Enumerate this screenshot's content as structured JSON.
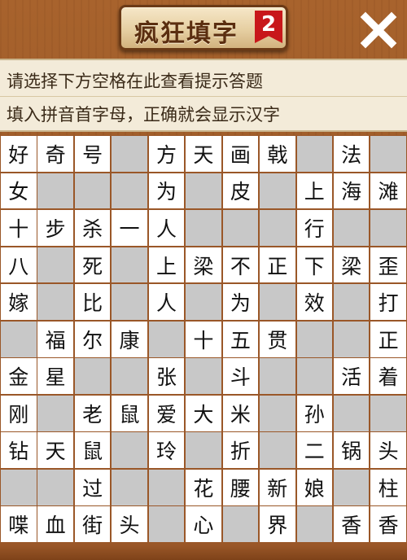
{
  "header": {
    "title": "疯狂填字",
    "level": "2",
    "close_icon": "close-x-icon"
  },
  "hint": {
    "line1": "请选择下方空格在此查看提示答题",
    "line2": "填入拼音首字母，正确就会显示汉字"
  },
  "colors": {
    "wood": "#9a5728",
    "plaque": "#e6cfa2",
    "badge": "#c8171b",
    "blocked_cell": "#c8c8c8",
    "open_cell": "#ffffff"
  },
  "grid": {
    "rows": [
      [
        "好",
        "奇",
        "号",
        null,
        "方",
        "天",
        "画",
        "戟",
        null,
        "法",
        null
      ],
      [
        "女",
        null,
        null,
        null,
        "为",
        null,
        "皮",
        null,
        "上",
        "海",
        "滩"
      ],
      [
        "十",
        "步",
        "杀",
        "一",
        "人",
        null,
        null,
        null,
        "行",
        null,
        null
      ],
      [
        "八",
        null,
        "死",
        null,
        "上",
        "梁",
        "不",
        "正",
        "下",
        "梁",
        "歪"
      ],
      [
        "嫁",
        null,
        "比",
        null,
        "人",
        null,
        "为",
        null,
        "效",
        null,
        "打"
      ],
      [
        null,
        "福",
        "尔",
        "康",
        null,
        "十",
        "五",
        "贯",
        null,
        null,
        "正"
      ],
      [
        "金",
        "星",
        null,
        null,
        "张",
        null,
        "斗",
        null,
        null,
        "活",
        "着"
      ],
      [
        "刚",
        null,
        "老",
        "鼠",
        "爱",
        "大",
        "米",
        null,
        "孙",
        null,
        null
      ],
      [
        "钻",
        "天",
        "鼠",
        null,
        "玲",
        null,
        "折",
        null,
        "二",
        "锅",
        "头"
      ],
      [
        null,
        null,
        "过",
        null,
        null,
        "花",
        "腰",
        "新",
        "娘",
        null,
        "柱"
      ],
      [
        "喋",
        "血",
        "街",
        "头",
        null,
        "心",
        null,
        "界",
        null,
        "香",
        "香"
      ]
    ]
  }
}
